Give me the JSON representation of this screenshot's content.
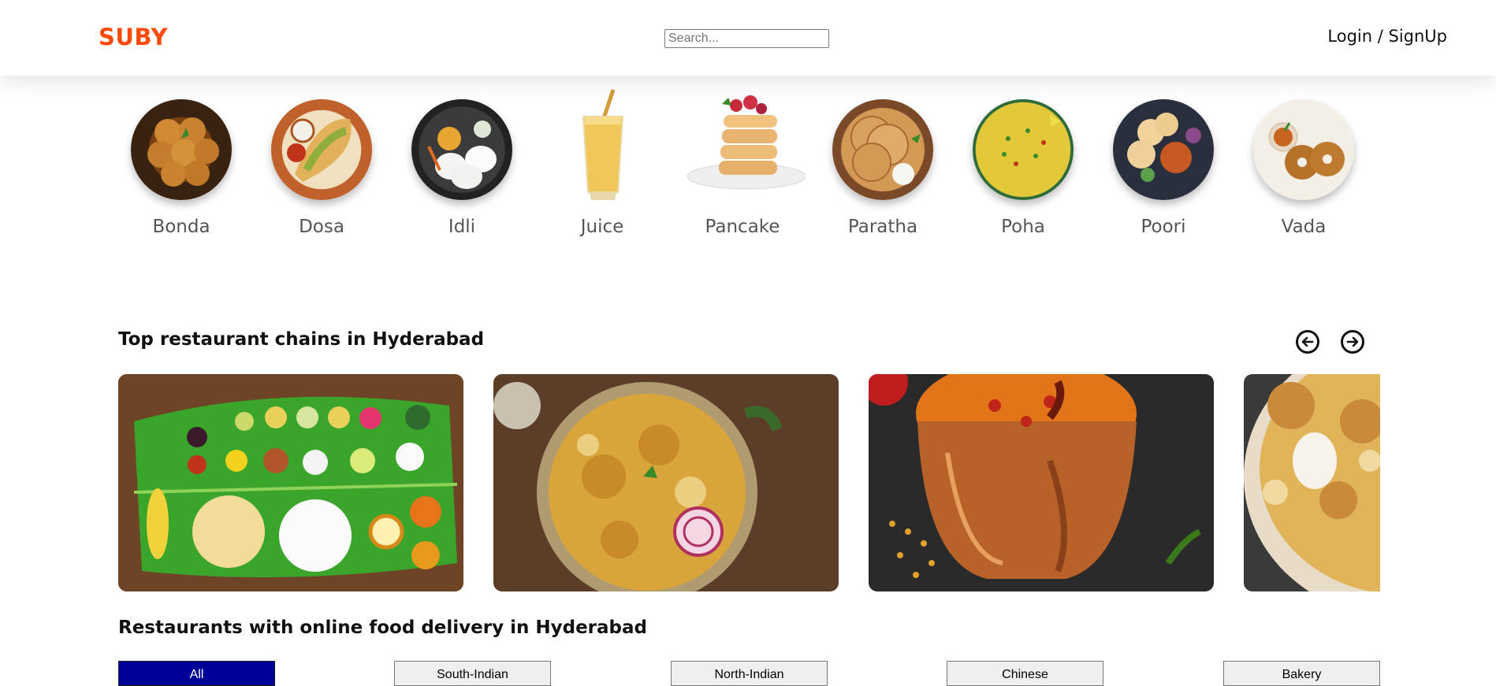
{
  "header": {
    "logo": "SUBY",
    "search_placeholder": "Search...",
    "login_label": "Login / SignUp"
  },
  "categories": [
    {
      "label": "Bonda",
      "icon": "bonda-dish-image"
    },
    {
      "label": "Dosa",
      "icon": "dosa-dish-image"
    },
    {
      "label": "Idli",
      "icon": "idli-dish-image"
    },
    {
      "label": "Juice",
      "icon": "juice-glass-image"
    },
    {
      "label": "Pancake",
      "icon": "pancake-stack-image"
    },
    {
      "label": "Paratha",
      "icon": "paratha-plate-image"
    },
    {
      "label": "Poha",
      "icon": "poha-bowl-image"
    },
    {
      "label": "Poori",
      "icon": "poori-plate-image"
    },
    {
      "label": "Vada",
      "icon": "vada-plate-image"
    }
  ],
  "top_chains": {
    "title": "Top restaurant chains in Hyderabad",
    "prev_icon": "arrow-left-circle-icon",
    "next_icon": "arrow-right-circle-icon",
    "cards": [
      {
        "name": "banana-leaf-meals-image"
      },
      {
        "name": "chicken-biryani-plate-image"
      },
      {
        "name": "dal-copper-bucket-image"
      },
      {
        "name": "egg-biryani-bowl-image"
      }
    ]
  },
  "delivery": {
    "title": "Restaurants with online food delivery in Hyderabad",
    "filters": [
      "All",
      "South-Indian",
      "North-Indian",
      "Chinese",
      "Bakery"
    ],
    "active_filter": "All"
  },
  "colors": {
    "brand": "#fc4a09",
    "active_filter": "#000099"
  }
}
